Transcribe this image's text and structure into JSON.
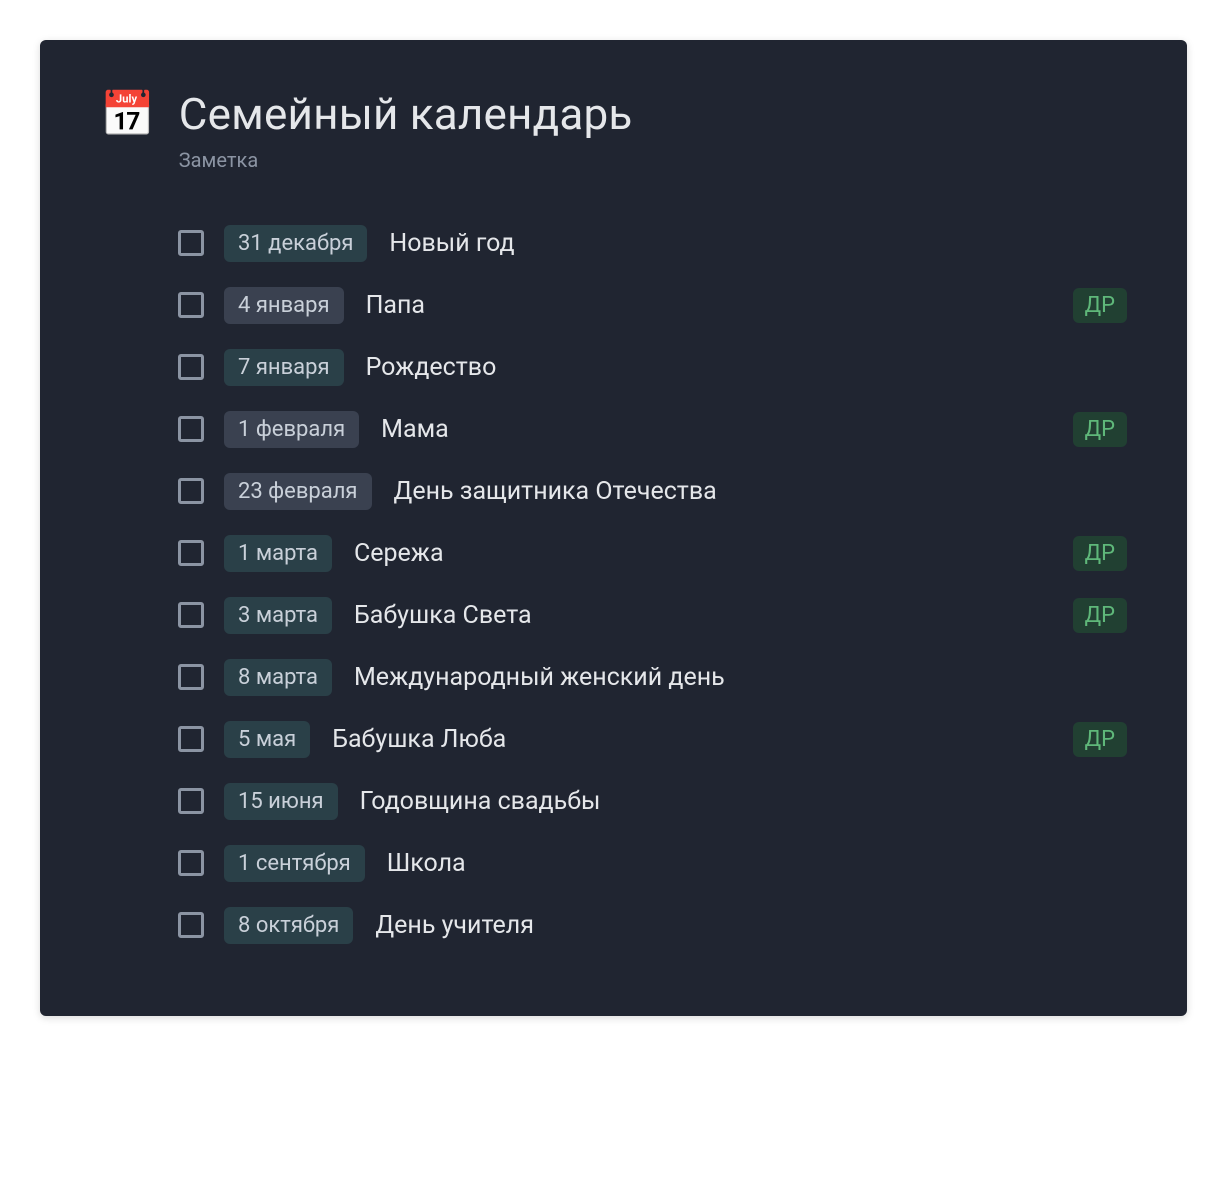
{
  "header": {
    "icon": "📅",
    "title": "Семейный календарь",
    "subtitle": "Заметка"
  },
  "colors": {
    "background": "#202531",
    "text": "#e5e7ea",
    "muted": "#8b94a3",
    "date_teal": "#2a4048",
    "date_grey": "#3a4150",
    "tag_bg": "#214032",
    "tag_fg": "#5fb87a"
  },
  "items": [
    {
      "checked": false,
      "date": "31 декабря",
      "date_style": "teal",
      "title": "Новый год",
      "tag": null
    },
    {
      "checked": false,
      "date": "4 января",
      "date_style": "grey",
      "title": "Папа",
      "tag": "ДР"
    },
    {
      "checked": false,
      "date": "7 января",
      "date_style": "teal",
      "title": "Рождество",
      "tag": null
    },
    {
      "checked": false,
      "date": "1 февраля",
      "date_style": "grey",
      "title": "Мама",
      "tag": "ДР"
    },
    {
      "checked": false,
      "date": "23 февраля",
      "date_style": "grey",
      "title": "День защитника Отечества",
      "tag": null
    },
    {
      "checked": false,
      "date": "1 марта",
      "date_style": "teal",
      "title": "Сережа",
      "tag": "ДР"
    },
    {
      "checked": false,
      "date": "3 марта",
      "date_style": "teal",
      "title": "Бабушка Света",
      "tag": "ДР"
    },
    {
      "checked": false,
      "date": "8 марта",
      "date_style": "teal",
      "title": "Международный женский день",
      "tag": null
    },
    {
      "checked": false,
      "date": "5 мая",
      "date_style": "teal",
      "title": "Бабушка Люба",
      "tag": "ДР"
    },
    {
      "checked": false,
      "date": "15 июня",
      "date_style": "teal",
      "title": "Годовщина свадьбы",
      "tag": null
    },
    {
      "checked": false,
      "date": "1 сентября",
      "date_style": "teal",
      "title": "Школа",
      "tag": null
    },
    {
      "checked": false,
      "date": "8 октября",
      "date_style": "teal",
      "title": "День учителя",
      "tag": null
    }
  ]
}
